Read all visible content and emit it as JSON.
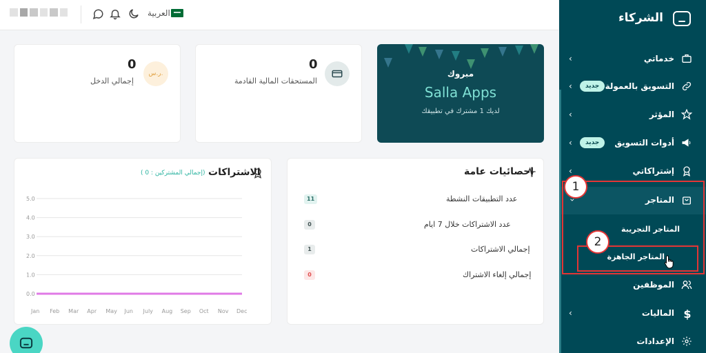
{
  "topbar": {
    "language": "العربية",
    "icons": [
      "moon-icon",
      "bell-icon",
      "chat-icon"
    ]
  },
  "stats": {
    "income": {
      "value": "0",
      "label": "إجمالي الدخل",
      "currency": "ر.س."
    },
    "upcoming": {
      "value": "0",
      "label": "المستحقات المالية القادمة"
    }
  },
  "promo": {
    "title": "مبروك",
    "app_name": "Salla Apps",
    "subtitle": "لديك 1 مشترك في تطبيقك"
  },
  "subscriptions": {
    "title": "الاشتراكات",
    "subtitle": "(إجمالي المشتركين : 0 )"
  },
  "general_stats": {
    "title": "إحصائيات عامة",
    "rows": [
      {
        "label": "عدد التطبيقات النشطة",
        "value": "11"
      },
      {
        "label": "عدد الاشتراكات خلال 7 ايام",
        "value": "0"
      },
      {
        "label": "إجمالي الاشتراكات",
        "value": "1"
      },
      {
        "label": "إجمالي إلغاء الاشتراك",
        "value": "0"
      }
    ]
  },
  "chart_data": {
    "type": "line",
    "categories": [
      "Jan",
      "Feb",
      "Mar",
      "Apr",
      "May",
      "Jun",
      "July",
      "Aug",
      "Sep",
      "Oct",
      "Nov",
      "Dec"
    ],
    "y_ticks": [
      "5.0",
      "4.0",
      "3.0",
      "2.0",
      "1.0",
      "0.0"
    ],
    "series": [
      {
        "values": [
          0,
          0,
          0,
          0,
          0,
          0,
          0,
          0,
          0,
          0,
          0,
          0
        ],
        "color": "#e07ae6"
      }
    ],
    "ylim": [
      0,
      5
    ],
    "grid": true,
    "title": "",
    "xlabel": "",
    "ylabel": ""
  },
  "sidebar": {
    "brand": "الشركاء",
    "new_badge": "جديد",
    "items": [
      {
        "label": "خدماتي"
      },
      {
        "label": "التسويق بالعمولة"
      },
      {
        "label": "المؤثر"
      },
      {
        "label": "أدوات التسويق"
      },
      {
        "label": "إشتراكاتي"
      },
      {
        "label": "المتاجر"
      },
      {
        "label": "الموظفين"
      },
      {
        "label": "الماليات"
      },
      {
        "label": "الإعدادات"
      }
    ],
    "sub_items": [
      {
        "label": "المتاجر التجريبة"
      },
      {
        "label": "المتاجر الجاهزة"
      }
    ]
  },
  "annotations": {
    "step1": "1",
    "step2": "2"
  },
  "colors": {
    "sidebar": "#004956",
    "accent": "#4ad6c4",
    "highlight": "#e53535"
  }
}
